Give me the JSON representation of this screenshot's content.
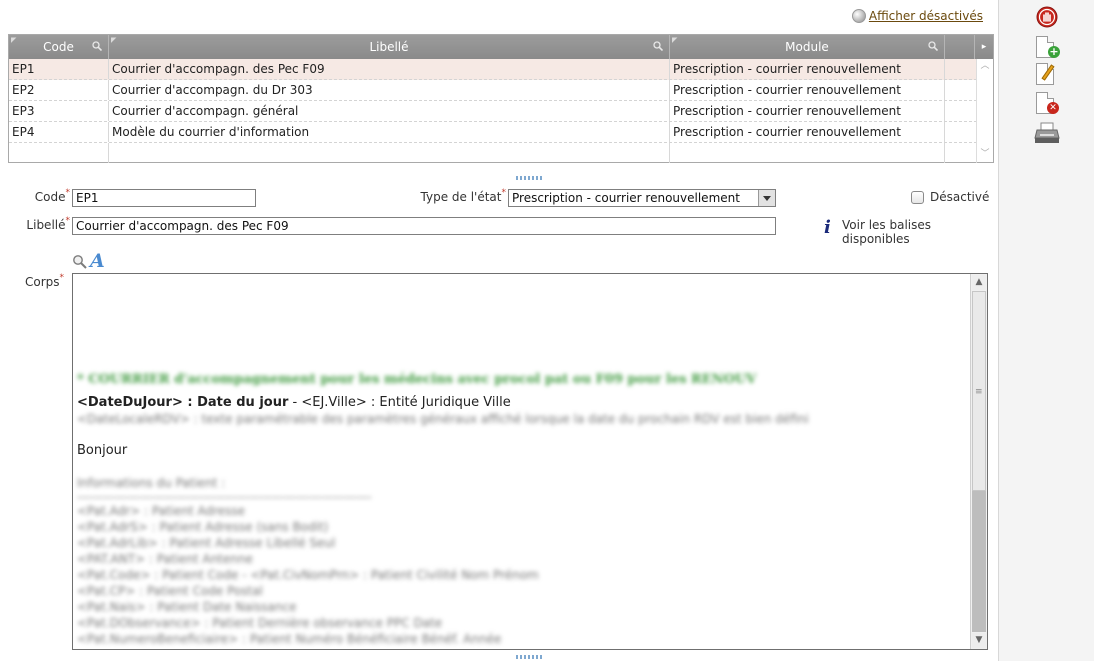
{
  "top_link": {
    "label": "Afficher désactivés"
  },
  "grid": {
    "columns": [
      "Code",
      "Libellé",
      "Module"
    ],
    "rows": [
      {
        "code": "EP1",
        "libelle": "Courrier d'accompagn. des Pec F09",
        "module": "Prescription - courrier renouvellement",
        "selected": true
      },
      {
        "code": "EP2",
        "libelle": "Courrier d'accompagn. du Dr 303",
        "module": "Prescription - courrier renouvellement"
      },
      {
        "code": "EP3",
        "libelle": "Courrier d'accompagn. général",
        "module": "Prescription - courrier renouvellement"
      },
      {
        "code": "EP4",
        "libelle": "Modèle du courrier d'information",
        "module": "Prescription - courrier renouvellement"
      }
    ]
  },
  "form": {
    "code_label": "Code",
    "code_value": "EP1",
    "type_label": "Type de l'état",
    "type_value": "Prescription - courrier renouvellement",
    "disabled_label": "Désactivé",
    "libelle_label": "Libellé",
    "libelle_value": "Courrier d'accompagn. des Pec F09",
    "tags_link": "Voir les balises disponibles",
    "body_label": "Corps"
  },
  "editor": {
    "green_line": "* COURRIER d'accompagnement pour les médecins avec procol pat ou F09 pour les RENOUV",
    "date_tag": "<DateDuJour> : Date du jour",
    "separator": " - ",
    "ville_tag": "<EJ.Ville>",
    "ville_desc": " : Entité Juridique Ville",
    "blurred_line_1": "<DateLocaleRDV> : texte paramétrable des paramètres généraux affiché lorsque la date du prochain RDV est bien défini",
    "greeting": "Bonjour",
    "blurred_section_title": "Informations du Patient :",
    "blurred_rule": "--------------------------------------------------------------------",
    "blurred_lines": [
      "<Pat.Adr> : Patient Adresse",
      "<Pat.AdrS> : Patient Adresse (sans Bodit)",
      "<Pat.AdrLib> : Patient Adresse Libellé Seul",
      "<PAT.ANT> : Patient Antenne",
      "<Pat.Code> : Patient Code - <Pat.CivNomPrn> : Patient Civilité Nom Prénom",
      "<Pat.CP> : Patient Code Postal",
      "<Pat.Nais> : Patient Date Naissance",
      "<Pat.DObservance> : Patient Dernière observance PPC Date"
    ],
    "cut_line": "<Pat.NumeroBeneficiaire> : Patient Numéro Bénéficiaire Bénéf. Année"
  },
  "toolbar_icons": [
    "stop-hand-icon",
    "new-document-icon",
    "edit-document-icon",
    "delete-document-icon",
    "printer-icon"
  ]
}
